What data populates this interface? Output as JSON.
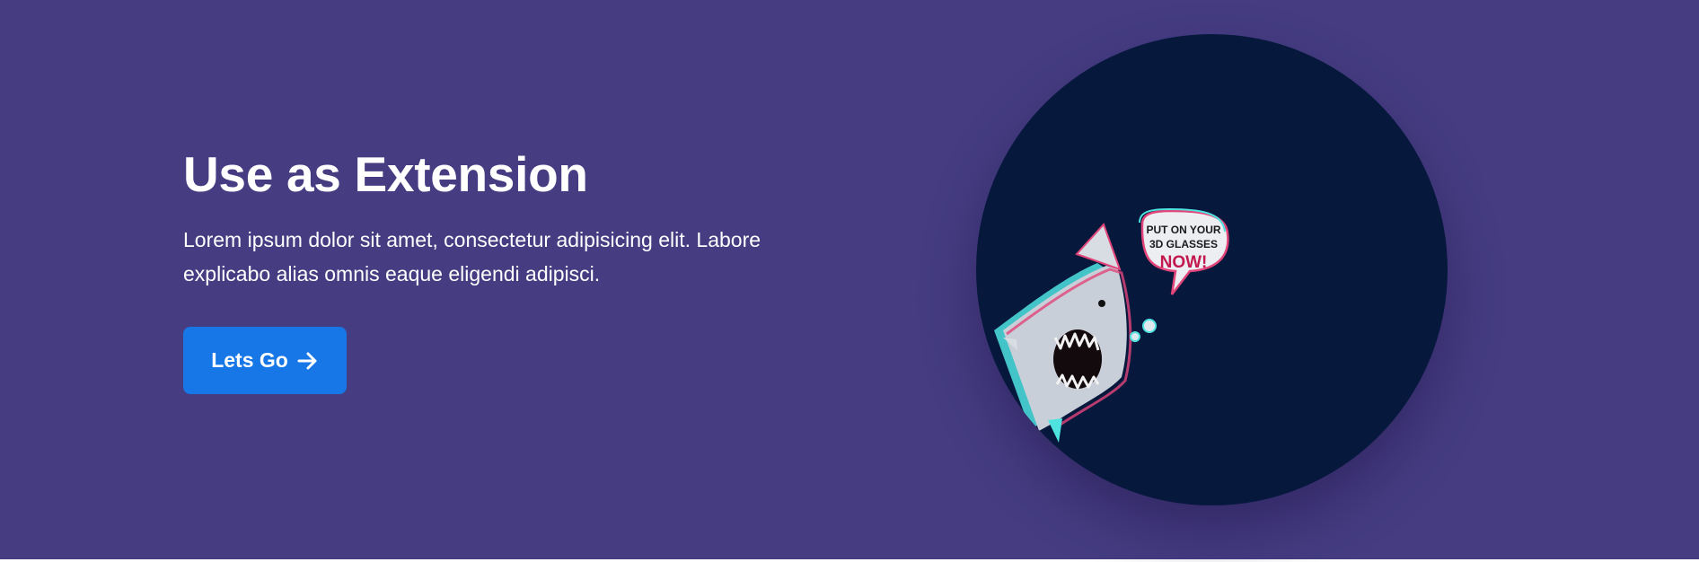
{
  "hero": {
    "title": "Use as Extension",
    "description": "Lorem ipsum dolor sit amet, consectetur adipisicing elit. Labore explicabo alias omnis eaque eligendi adipisci.",
    "cta_label": "Lets Go",
    "cta_icon": "arrow-right-icon"
  },
  "illustration": {
    "speech_line1": "PUT ON YOUR",
    "speech_line2": "3D GLASSES",
    "speech_line3": "NOW!"
  },
  "colors": {
    "background": "#453c82",
    "button": "#1877e7",
    "circle": "#06183c"
  }
}
